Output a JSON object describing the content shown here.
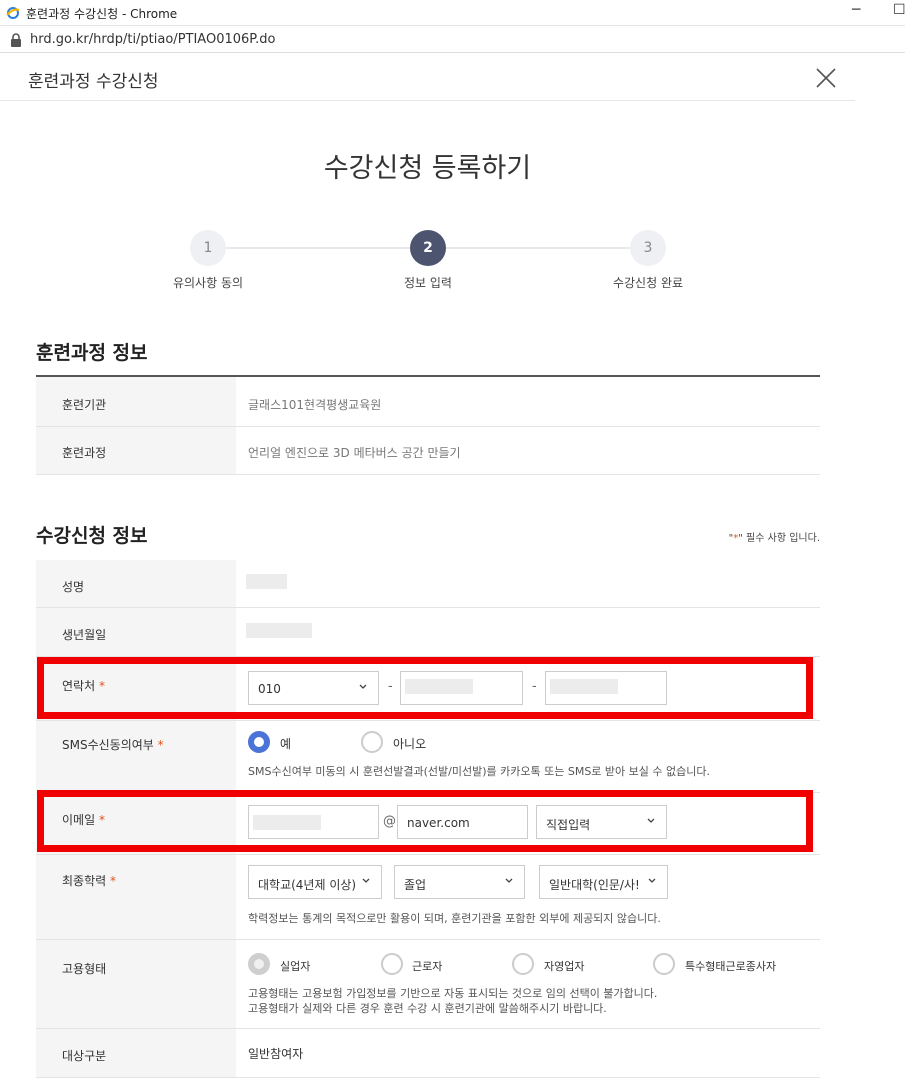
{
  "browser": {
    "tab_title": "훈련과정 수강신청 - Chrome",
    "url": "hrd.go.kr/hrdp/ti/ptiao/PTIAO0106P.do"
  },
  "modal": {
    "title": "훈련과정 수강신청",
    "page_title": "수강신청 등록하기"
  },
  "steps": [
    {
      "number": "1",
      "label": "유의사항 동의"
    },
    {
      "number": "2",
      "label": "정보 입력"
    },
    {
      "number": "3",
      "label": "수강신청 완료"
    }
  ],
  "course_info": {
    "title": "훈련과정 정보",
    "institution_label": "훈련기관",
    "institution_value": "글래스101현격평생교육원",
    "course_label": "훈련과정",
    "course_value": "언리얼 엔진으로 3D 메타버스 공간 만들기"
  },
  "apply_info": {
    "title": "수강신청 정보",
    "required_note_prefix": "\"",
    "required_note_star": "*",
    "required_note_suffix": "\" 필수 사항 입니다.",
    "name_label": "성명",
    "birth_label": "생년월일",
    "phone_label": "연락처",
    "phone_prefix": "010",
    "phone_dash": "-",
    "sms_label": "SMS수신동의여부",
    "sms_yes": "예",
    "sms_no": "아니오",
    "sms_help": "SMS수신여부 미동의 시 훈련선발결과(선발/미선발)를 카카오톡 또는 SMS로 받아 보실 수 없습니다.",
    "email_label": "이메일",
    "email_at": "@",
    "email_domain": "naver.com",
    "email_select": "직접입력",
    "education_label": "최종학력",
    "education_level": "대학교(4년제 이상)",
    "education_status": "졸업",
    "education_type": "일반대학(인문/사!",
    "education_help": "학력정보는 통계의 목적으로만 활용이 되며, 훈련기관을 포함한 외부에 제공되지 않습니다.",
    "employment_label": "고용형태",
    "employment_options": [
      "실업자",
      "근로자",
      "자영업자",
      "특수형태근로종사자"
    ],
    "employment_help_1": "고용형태는 고용보험 가입정보를 기반으로 자동 표시되는 것으로 임의 선택이 불가합니다.",
    "employment_help_2": "고용형태가 실제와 다른 경우 훈련 수강 시 훈련기관에 말씀해주시기 바랍니다.",
    "target_label": "대상구분",
    "target_value": "일반참여자",
    "required_star": "*"
  }
}
